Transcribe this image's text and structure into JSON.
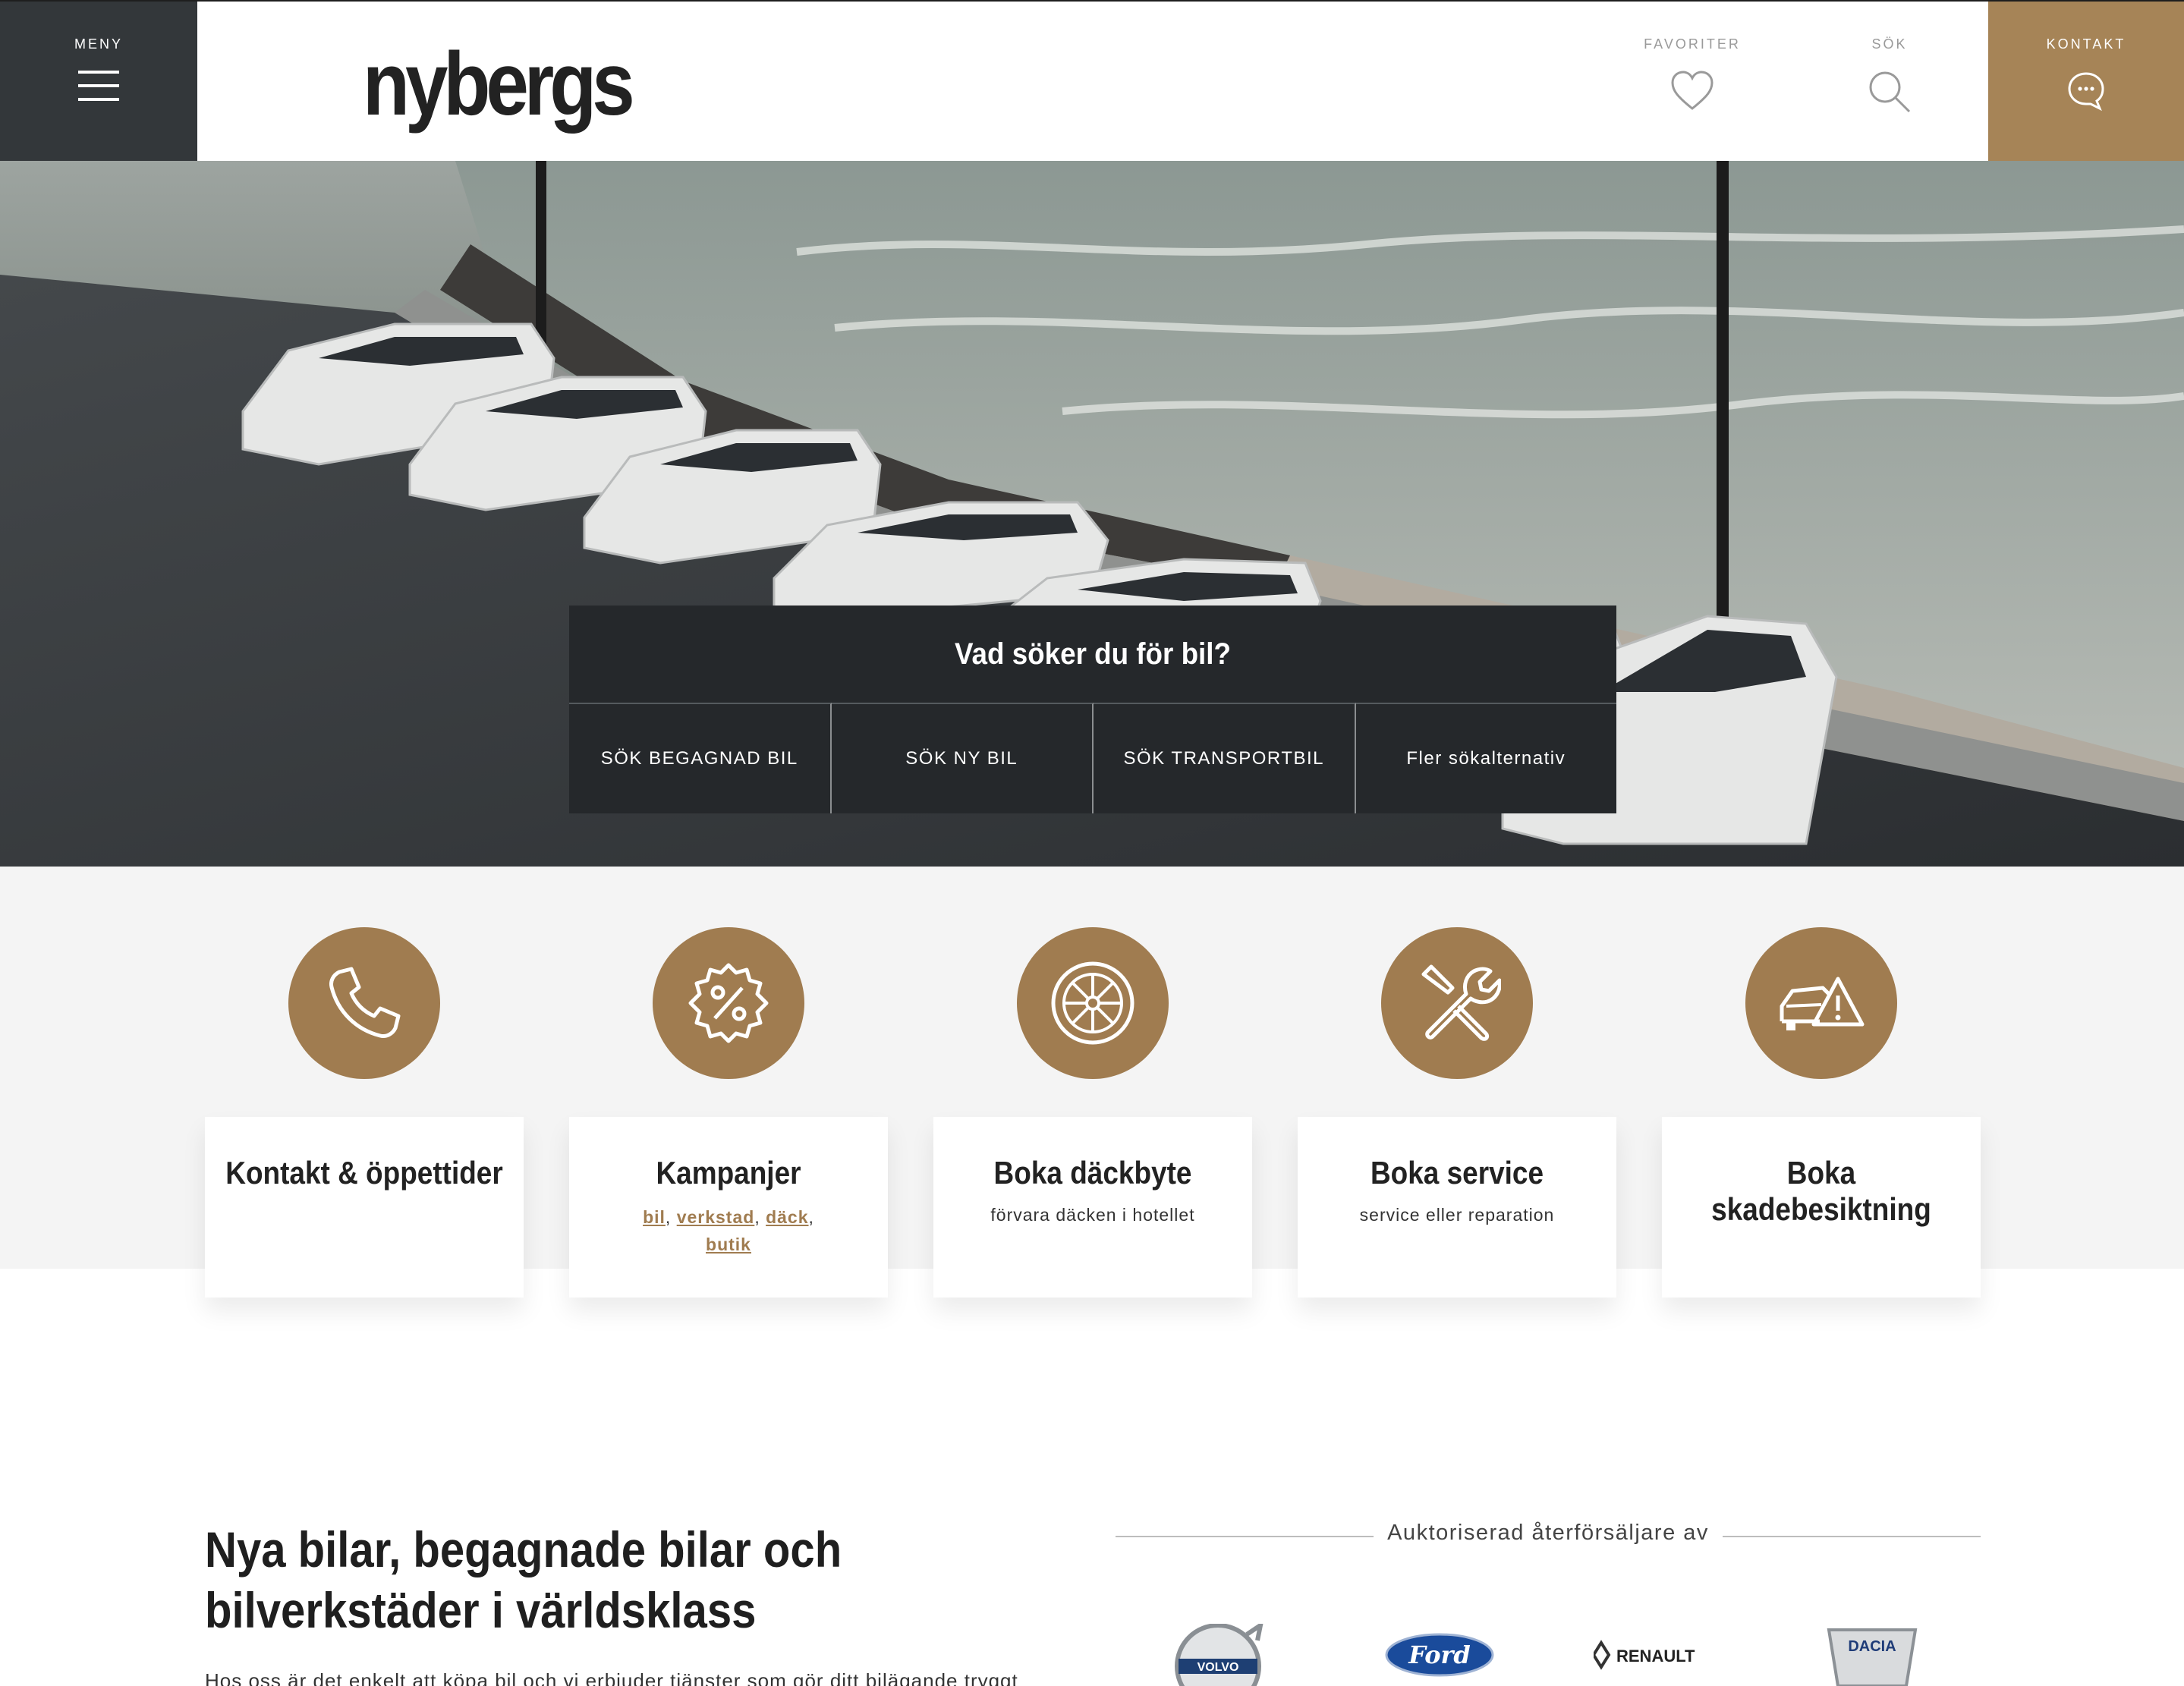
{
  "header": {
    "menu_label": "MENY",
    "logo": "nybergs",
    "favorites_label": "FAVORITER",
    "search_label": "SÖK",
    "contact_label": "KONTAKT"
  },
  "hero": {
    "search_title": "Vad söker du för bil?",
    "options": [
      "SÖK BEGAGNAD BIL",
      "SÖK NY BIL",
      "SÖK TRANSPORTBIL",
      "Fler sökalternativ"
    ]
  },
  "services": [
    {
      "icon": "phone-icon",
      "title": "Kontakt & öppettider",
      "subtitle": ""
    },
    {
      "icon": "percent-badge-icon",
      "title": "Kampanjer",
      "links": [
        "bil",
        "verkstad",
        "däck",
        "butik"
      ]
    },
    {
      "icon": "tire-icon",
      "title": "Boka däckbyte",
      "subtitle": "förvara däcken i hotellet"
    },
    {
      "icon": "tools-icon",
      "title": "Boka service",
      "subtitle": "service eller reparation"
    },
    {
      "icon": "car-damage-icon",
      "title": "Boka skadebesiktning",
      "subtitle": ""
    }
  ],
  "main": {
    "headline": "Nya bilar, begagnade bilar och bilverkstäder i världsklass",
    "intro": "Hos oss är det enkelt att köpa bil och vi erbjuder tjänster som gör ditt bilägande tryggt"
  },
  "dealer": {
    "label": "Auktoriserad återförsäljare av",
    "brands": [
      "VOLVO",
      "Ford",
      "RENAULT",
      "DACIA"
    ]
  },
  "colors": {
    "accent": "#a68457",
    "dark": "#33373a",
    "search_bg": "#25282b",
    "services_bg": "#f4f4f4"
  }
}
